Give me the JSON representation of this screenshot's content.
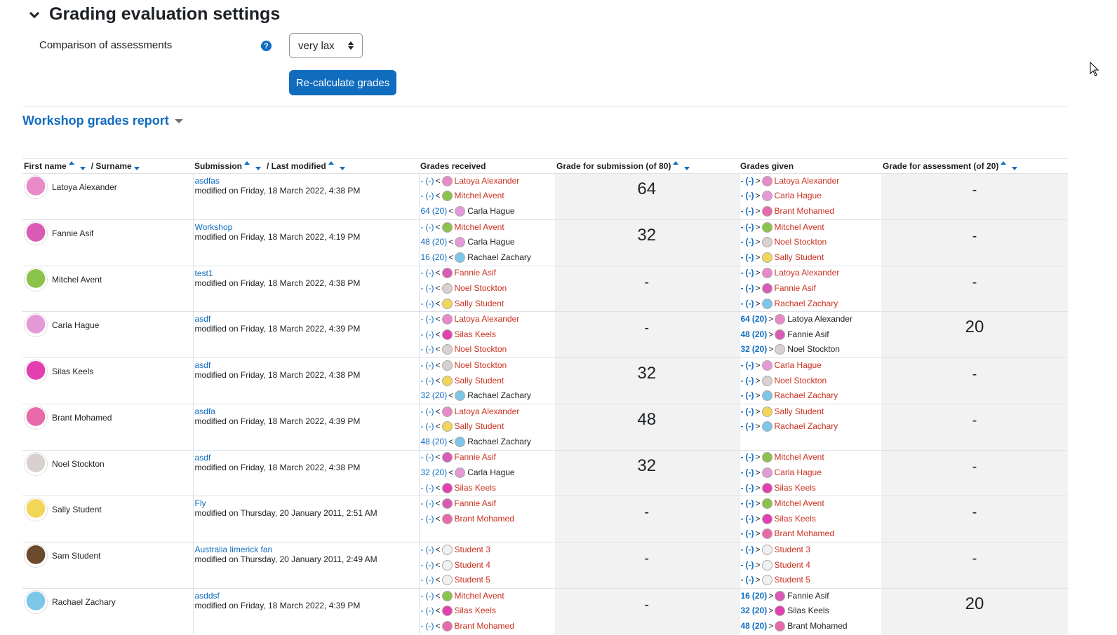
{
  "section": {
    "title": "Grading evaluation settings"
  },
  "settings": {
    "comparison_label": "Comparison of assessments",
    "comparison_value": "very lax",
    "recalc_label": "Re-calculate grades"
  },
  "report": {
    "title": "Workshop grades report",
    "headers": {
      "first_name": "First name",
      "surname": "/ Surname",
      "submission": "Submission",
      "last_modified": "/ Last modified",
      "grades_received": "Grades received",
      "grade_submission": "Grade for submission (of 80)",
      "grades_given": "Grades given",
      "grade_assessment": "Grade for assessment (of 20)"
    },
    "rows": [
      {
        "name": "Latoya Alexander",
        "sub_title": "asdfas",
        "sub_modified": "modified on Friday, 18 March 2022, 4:38 PM",
        "grade_submission": "64",
        "grade_assessment": "-",
        "received": [
          {
            "g": "-",
            "w": "(-)",
            "dir": "<",
            "who": "Latoya Alexander",
            "red": true
          },
          {
            "g": "-",
            "w": "(-)",
            "dir": "<",
            "who": "Mitchel Avent",
            "red": true
          },
          {
            "g": "64",
            "w": "(20)",
            "dir": "<",
            "who": "Carla Hague",
            "red": false
          }
        ],
        "given": [
          {
            "g": "-",
            "w": "(-)",
            "dir": ">",
            "who": "Latoya Alexander",
            "red": true
          },
          {
            "g": "-",
            "w": "(-)",
            "dir": ">",
            "who": "Carla Hague",
            "red": true
          },
          {
            "g": "-",
            "w": "(-)",
            "dir": ">",
            "who": "Brant Mohamed",
            "red": true
          }
        ]
      },
      {
        "name": "Fannie Asif",
        "sub_title": "Workshop",
        "sub_modified": "modified on Friday, 18 March 2022, 4:19 PM",
        "grade_submission": "32",
        "grade_assessment": "-",
        "received": [
          {
            "g": "-",
            "w": "(-)",
            "dir": "<",
            "who": "Mitchel Avent",
            "red": true
          },
          {
            "g": "48",
            "w": "(20)",
            "dir": "<",
            "who": "Carla Hague",
            "red": false
          },
          {
            "g": "16",
            "w": "(20)",
            "dir": "<",
            "who": "Rachael Zachary",
            "red": false
          }
        ],
        "given": [
          {
            "g": "-",
            "w": "(-)",
            "dir": ">",
            "who": "Mitchel Avent",
            "red": true
          },
          {
            "g": "-",
            "w": "(-)",
            "dir": ">",
            "who": "Noel Stockton",
            "red": true
          },
          {
            "g": "-",
            "w": "(-)",
            "dir": ">",
            "who": "Sally Student",
            "red": true
          }
        ]
      },
      {
        "name": "Mitchel Avent",
        "sub_title": "test1",
        "sub_modified": "modified on Friday, 18 March 2022, 4:38 PM",
        "grade_submission": "-",
        "grade_assessment": "-",
        "received": [
          {
            "g": "-",
            "w": "(-)",
            "dir": "<",
            "who": "Fannie Asif",
            "red": true
          },
          {
            "g": "-",
            "w": "(-)",
            "dir": "<",
            "who": "Noel Stockton",
            "red": true
          },
          {
            "g": "-",
            "w": "(-)",
            "dir": "<",
            "who": "Sally Student",
            "red": true
          }
        ],
        "given": [
          {
            "g": "-",
            "w": "(-)",
            "dir": ">",
            "who": "Latoya Alexander",
            "red": true
          },
          {
            "g": "-",
            "w": "(-)",
            "dir": ">",
            "who": "Fannie Asif",
            "red": true
          },
          {
            "g": "-",
            "w": "(-)",
            "dir": ">",
            "who": "Rachael Zachary",
            "red": true
          }
        ]
      },
      {
        "name": "Carla Hague",
        "sub_title": "asdf",
        "sub_modified": "modified on Friday, 18 March 2022, 4:39 PM",
        "grade_submission": "-",
        "grade_assessment": "20",
        "received": [
          {
            "g": "-",
            "w": "(-)",
            "dir": "<",
            "who": "Latoya Alexander",
            "red": true
          },
          {
            "g": "-",
            "w": "(-)",
            "dir": "<",
            "who": "Silas Keels",
            "red": true
          },
          {
            "g": "-",
            "w": "(-)",
            "dir": "<",
            "who": "Noel Stockton",
            "red": true
          }
        ],
        "given": [
          {
            "g": "64",
            "w": "(20)",
            "dir": ">",
            "who": "Latoya Alexander",
            "red": false
          },
          {
            "g": "48",
            "w": "(20)",
            "dir": ">",
            "who": "Fannie Asif",
            "red": false
          },
          {
            "g": "32",
            "w": "(20)",
            "dir": ">",
            "who": "Noel Stockton",
            "red": false
          }
        ]
      },
      {
        "name": "Silas Keels",
        "sub_title": "asdf",
        "sub_modified": "modified on Friday, 18 March 2022, 4:38 PM",
        "grade_submission": "32",
        "grade_assessment": "-",
        "received": [
          {
            "g": "-",
            "w": "(-)",
            "dir": "<",
            "who": "Noel Stockton",
            "red": true
          },
          {
            "g": "-",
            "w": "(-)",
            "dir": "<",
            "who": "Sally Student",
            "red": true
          },
          {
            "g": "32",
            "w": "(20)",
            "dir": "<",
            "who": "Rachael Zachary",
            "red": false
          }
        ],
        "given": [
          {
            "g": "-",
            "w": "(-)",
            "dir": ">",
            "who": "Carla Hague",
            "red": true
          },
          {
            "g": "-",
            "w": "(-)",
            "dir": ">",
            "who": "Noel Stockton",
            "red": true
          },
          {
            "g": "-",
            "w": "(-)",
            "dir": ">",
            "who": "Rachael Zachary",
            "red": true
          }
        ]
      },
      {
        "name": "Brant Mohamed",
        "sub_title": "asdfa",
        "sub_modified": "modified on Friday, 18 March 2022, 4:39 PM",
        "grade_submission": "48",
        "grade_assessment": "-",
        "received": [
          {
            "g": "-",
            "w": "(-)",
            "dir": "<",
            "who": "Latoya Alexander",
            "red": true
          },
          {
            "g": "-",
            "w": "(-)",
            "dir": "<",
            "who": "Sally Student",
            "red": true
          },
          {
            "g": "48",
            "w": "(20)",
            "dir": "<",
            "who": "Rachael Zachary",
            "red": false
          }
        ],
        "given": [
          {
            "g": "-",
            "w": "(-)",
            "dir": ">",
            "who": "Sally Student",
            "red": true
          },
          {
            "g": "-",
            "w": "(-)",
            "dir": ">",
            "who": "Rachael Zachary",
            "red": true
          }
        ]
      },
      {
        "name": "Noel Stockton",
        "sub_title": "asdf",
        "sub_modified": "modified on Friday, 18 March 2022, 4:38 PM",
        "grade_submission": "32",
        "grade_assessment": "-",
        "received": [
          {
            "g": "-",
            "w": "(-)",
            "dir": "<",
            "who": "Fannie Asif",
            "red": true
          },
          {
            "g": "32",
            "w": "(20)",
            "dir": "<",
            "who": "Carla Hague",
            "red": false
          },
          {
            "g": "-",
            "w": "(-)",
            "dir": "<",
            "who": "Silas Keels",
            "red": true
          }
        ],
        "given": [
          {
            "g": "-",
            "w": "(-)",
            "dir": ">",
            "who": "Mitchel Avent",
            "red": true
          },
          {
            "g": "-",
            "w": "(-)",
            "dir": ">",
            "who": "Carla Hague",
            "red": true
          },
          {
            "g": "-",
            "w": "(-)",
            "dir": ">",
            "who": "Silas Keels",
            "red": true
          }
        ]
      },
      {
        "name": "Sally Student",
        "sub_title": "Fly",
        "sub_modified": "modified on Thursday, 20 January 2011, 2:51 AM",
        "grade_submission": "-",
        "grade_assessment": "-",
        "received": [
          {
            "g": "-",
            "w": "(-)",
            "dir": "<",
            "who": "Fannie Asif",
            "red": true
          },
          {
            "g": "-",
            "w": "(-)",
            "dir": "<",
            "who": "Brant Mohamed",
            "red": true
          }
        ],
        "given": [
          {
            "g": "-",
            "w": "(-)",
            "dir": ">",
            "who": "Mitchel Avent",
            "red": true
          },
          {
            "g": "-",
            "w": "(-)",
            "dir": ">",
            "who": "Silas Keels",
            "red": true
          },
          {
            "g": "-",
            "w": "(-)",
            "dir": ">",
            "who": "Brant Mohamed",
            "red": true
          }
        ]
      },
      {
        "name": "Sam Student",
        "sub_title": "Australia limerick fan",
        "sub_modified": "modified on Thursday, 20 January 2011, 2:49 AM",
        "grade_submission": "-",
        "grade_assessment": "-",
        "received": [
          {
            "g": "-",
            "w": "(-)",
            "dir": "<",
            "who": "Student 3",
            "red": true
          },
          {
            "g": "-",
            "w": "(-)",
            "dir": "<",
            "who": "Student 4",
            "red": true
          },
          {
            "g": "-",
            "w": "(-)",
            "dir": "<",
            "who": "Student 5",
            "red": true
          }
        ],
        "given": [
          {
            "g": "-",
            "w": "(-)",
            "dir": ">",
            "who": "Student 3",
            "red": true
          },
          {
            "g": "-",
            "w": "(-)",
            "dir": ">",
            "who": "Student 4",
            "red": true
          },
          {
            "g": "-",
            "w": "(-)",
            "dir": ">",
            "who": "Student 5",
            "red": true
          }
        ]
      },
      {
        "name": "Rachael Zachary",
        "sub_title": "asddsf",
        "sub_modified": "modified on Friday, 18 March 2022, 4:39 PM",
        "grade_submission": "-",
        "grade_assessment": "20",
        "received": [
          {
            "g": "-",
            "w": "(-)",
            "dir": "<",
            "who": "Mitchel Avent",
            "red": true
          },
          {
            "g": "-",
            "w": "(-)",
            "dir": "<",
            "who": "Silas Keels",
            "red": true
          },
          {
            "g": "-",
            "w": "(-)",
            "dir": "<",
            "who": "Brant Mohamed",
            "red": true
          }
        ],
        "given": [
          {
            "g": "16",
            "w": "(20)",
            "dir": ">",
            "who": "Fannie Asif",
            "red": false
          },
          {
            "g": "32",
            "w": "(20)",
            "dir": ">",
            "who": "Silas Keels",
            "red": false
          },
          {
            "g": "48",
            "w": "(20)",
            "dir": ">",
            "who": "Brant Mohamed",
            "red": false
          }
        ]
      }
    ]
  },
  "avatar_colors": {
    "Latoya Alexander": "#e889c8",
    "Fannie Asif": "#d95bb4",
    "Mitchel Avent": "#8bc34a",
    "Carla Hague": "#e49ad6",
    "Silas Keels": "#e23fb0",
    "Brant Mohamed": "#e86aa8",
    "Noel Stockton": "#d9d0d0",
    "Sally Student": "#f2d65a",
    "Sam Student": "#6b4a2e",
    "Rachael Zachary": "#7cc7e8",
    "Student 3": "#f0f0f0",
    "Student 4": "#f0f0f0",
    "Student 5": "#f0f0f0"
  },
  "colors": {
    "accent": "#0f6cbf",
    "danger": "#ca3120"
  }
}
